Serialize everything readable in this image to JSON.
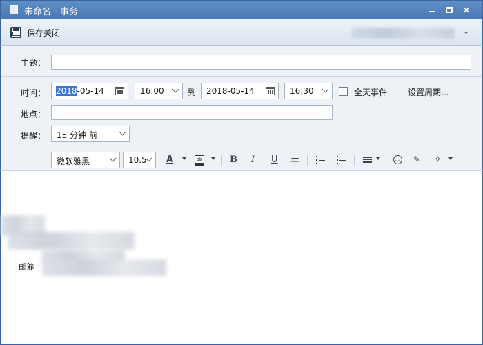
{
  "window": {
    "title": "未命名 - 事务",
    "minimize": "",
    "maximize": "",
    "close": "✕"
  },
  "toolbar": {
    "save_close_label": "保存关闭",
    "overflow": "⌄"
  },
  "form": {
    "subject_label": "主题：",
    "subject_value": "",
    "time_label": "时间：",
    "start_date": {
      "selected": "2018",
      "rest": "-05-14"
    },
    "start_time": "16:00",
    "to_label": "到",
    "end_date": "2018-05-14",
    "end_time": "16:30",
    "all_day_label": "全天事件",
    "all_day_checked": false,
    "recurrence_link": "设置周期...",
    "location_label": "地点：",
    "location_value": "",
    "reminder_label": "提醒：",
    "reminder_value": "15 分钟 前"
  },
  "format_bar": {
    "font_family": "微软雅黑",
    "font_size": "10.5",
    "font_color_glyph": "A",
    "highlight_glyph": "ab",
    "bold": "B",
    "italic": "I",
    "underline": "U",
    "strike": "干"
  },
  "editor": {
    "signature_label": "邮箱"
  },
  "colors": {
    "titlebar": "#4a78b4",
    "accent": "#3a77d4",
    "panel": "#eef1f6"
  }
}
